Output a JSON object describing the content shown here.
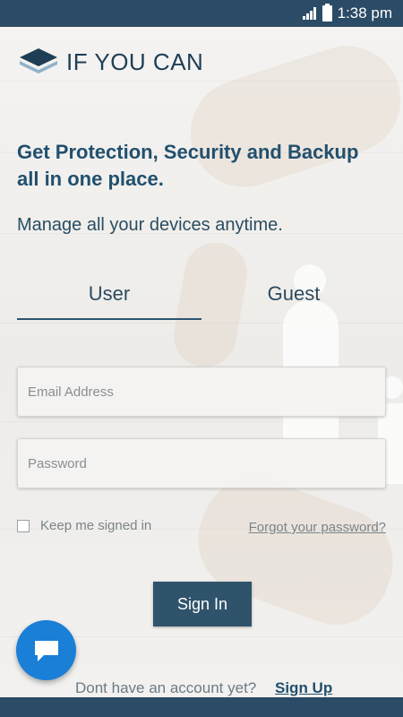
{
  "status_bar": {
    "time": "1:38 pm",
    "icons": [
      "signal-icon",
      "battery-icon"
    ]
  },
  "app": {
    "logo_text": "IF YOU CAN"
  },
  "hero": {
    "headline": "Get Protection, Security and Backup all in one place.",
    "subline": "Manage all your devices anytime."
  },
  "tabs": [
    {
      "label": "User",
      "selected": true
    },
    {
      "label": "Guest",
      "selected": false
    }
  ],
  "form": {
    "email_placeholder": "Email Address",
    "email_value": "",
    "password_placeholder": "Password",
    "password_value": "",
    "remember_label": "Keep me signed in",
    "remember_checked": false,
    "forgot_label": "Forgot your password?",
    "signin_label": "Sign In"
  },
  "footer": {
    "prompt": "Dont have an account yet?",
    "signup_label": "Sign Up"
  },
  "chat": {
    "icon": "chat-bubble-icon"
  },
  "colors": {
    "brand_dark": "#2b4b66",
    "accent": "#21506e",
    "button": "#2f536b",
    "chat_fab": "#1a7fd6"
  }
}
